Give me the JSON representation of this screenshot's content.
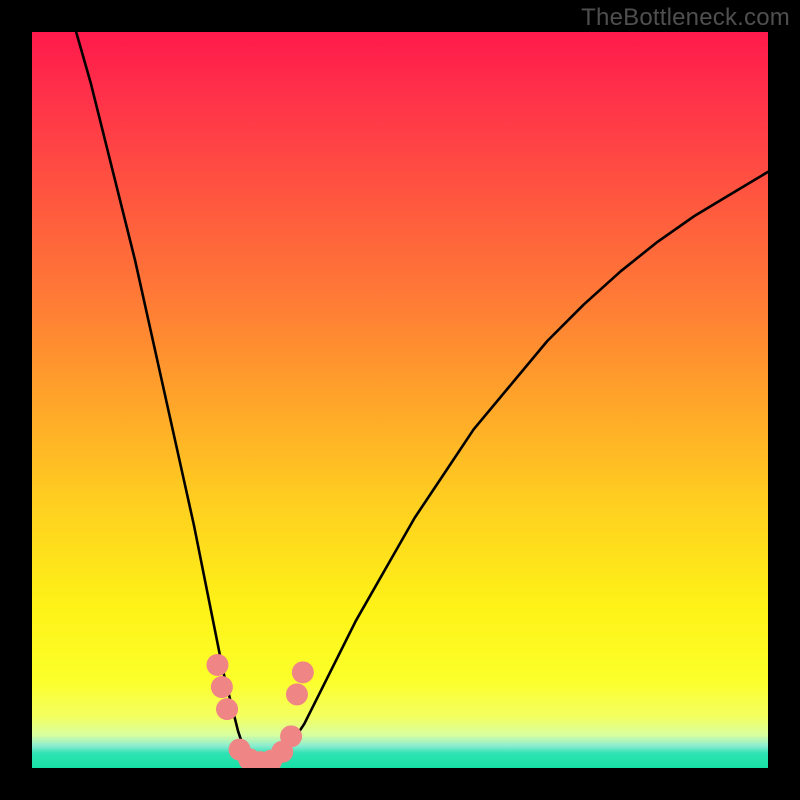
{
  "watermark": "TheBottleneck.com",
  "chart_data": {
    "type": "line",
    "title": "",
    "xlabel": "",
    "ylabel": "",
    "xlim": [
      0,
      100
    ],
    "ylim": [
      0,
      100
    ],
    "grid": false,
    "series": [
      {
        "name": "bottleneck-curve",
        "x": [
          6,
          8,
          10,
          12,
          14,
          16,
          18,
          20,
          22,
          24,
          25,
          26,
          27,
          28,
          29,
          30,
          31,
          32,
          33,
          34,
          35,
          37,
          40,
          44,
          48,
          52,
          56,
          60,
          65,
          70,
          75,
          80,
          85,
          90,
          95,
          100
        ],
        "values": [
          100,
          93,
          85,
          77,
          69,
          60,
          51,
          42,
          33,
          23,
          18,
          13,
          9,
          5,
          2,
          0.5,
          0,
          0,
          0.5,
          1.5,
          3,
          6,
          12,
          20,
          27,
          34,
          40,
          46,
          52,
          58,
          63,
          67.5,
          71.5,
          75,
          78,
          81
        ]
      }
    ],
    "markers": [
      {
        "x": 25.2,
        "y": 14
      },
      {
        "x": 25.8,
        "y": 11
      },
      {
        "x": 26.5,
        "y": 8
      },
      {
        "x": 28.2,
        "y": 2.5
      },
      {
        "x": 29.5,
        "y": 1.2
      },
      {
        "x": 31.0,
        "y": 0.8
      },
      {
        "x": 32.5,
        "y": 1.0
      },
      {
        "x": 34.0,
        "y": 2.2
      },
      {
        "x": 35.2,
        "y": 4.3
      },
      {
        "x": 36.0,
        "y": 10
      },
      {
        "x": 36.8,
        "y": 13
      }
    ],
    "gradient_stops": [
      {
        "pct": 0,
        "color": "#ff1a4b"
      },
      {
        "pct": 8,
        "color": "#ff2f4a"
      },
      {
        "pct": 22,
        "color": "#ff5540"
      },
      {
        "pct": 36,
        "color": "#ff7a36"
      },
      {
        "pct": 50,
        "color": "#ffa42a"
      },
      {
        "pct": 64,
        "color": "#ffcf20"
      },
      {
        "pct": 78,
        "color": "#fef217"
      },
      {
        "pct": 88,
        "color": "#fcff2a"
      },
      {
        "pct": 93,
        "color": "#f4ff60"
      },
      {
        "pct": 95.5,
        "color": "#d9ffa0"
      },
      {
        "pct": 97,
        "color": "#8aeccf"
      },
      {
        "pct": 98,
        "color": "#2fe3b4"
      },
      {
        "pct": 100,
        "color": "#17e0a4"
      }
    ],
    "marker_color": "#f08585"
  }
}
